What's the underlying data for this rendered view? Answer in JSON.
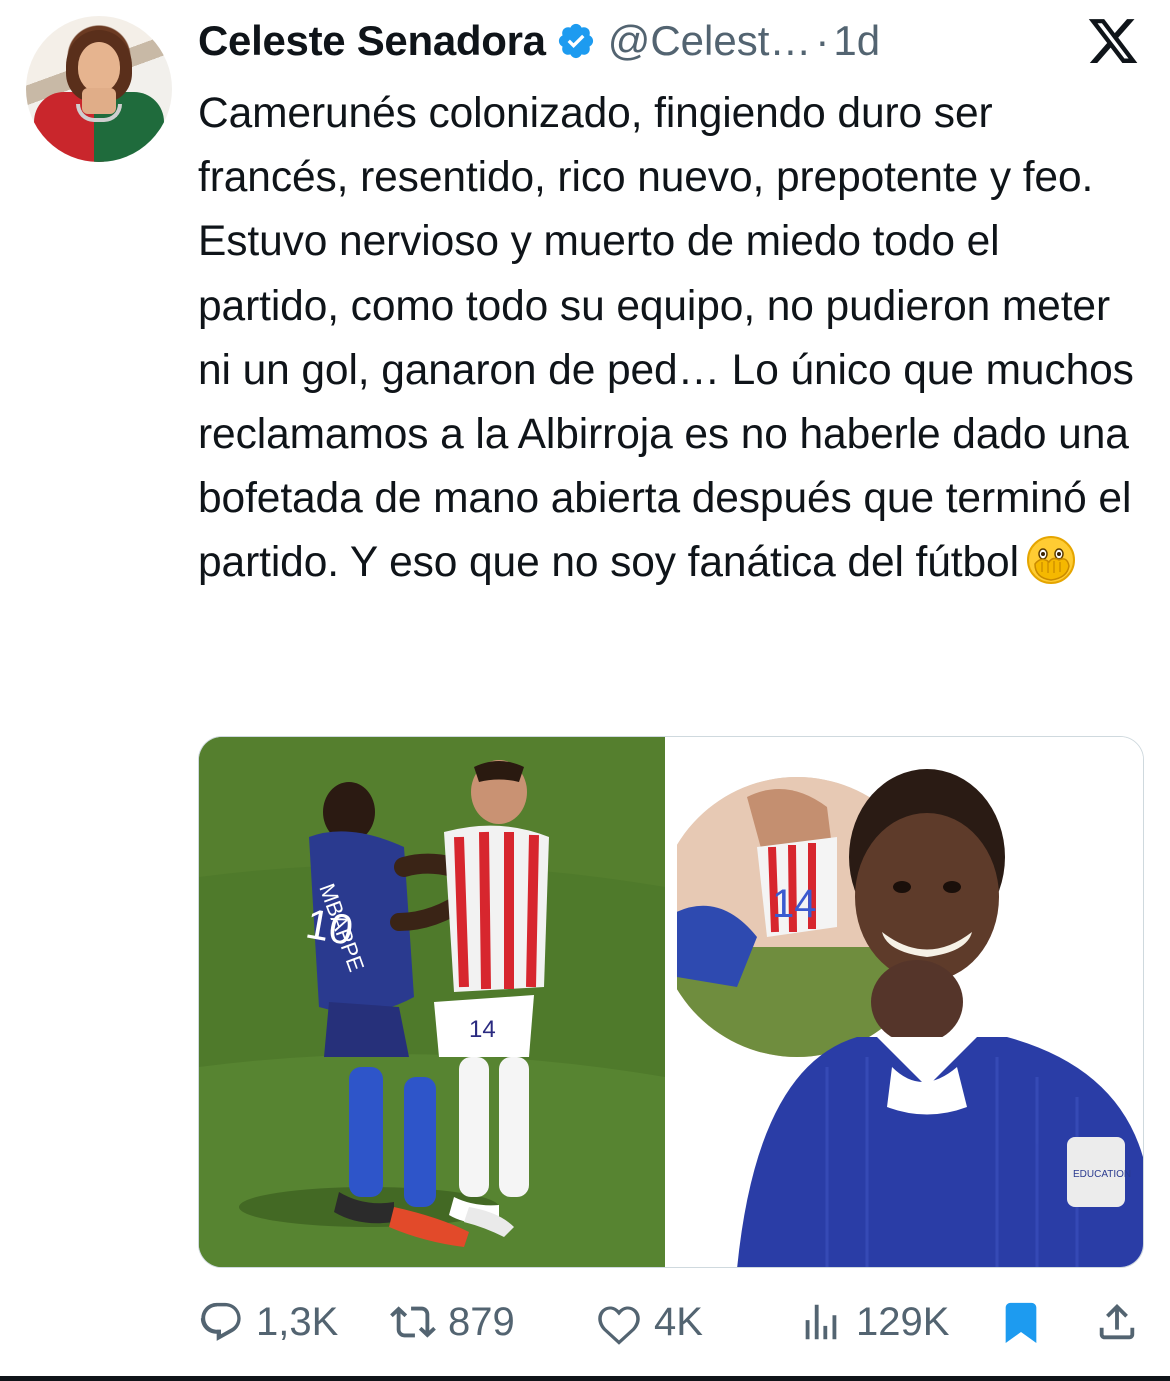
{
  "author": {
    "name": "Celeste Senadora",
    "handle": "@Celest…",
    "separator": "·",
    "time": "1d"
  },
  "tweet": {
    "text": "Camerunés colonizado, fingiendo duro ser francés, resentido, rico nuevo, prepotente y feo. Estuvo nervioso y muerto de miedo todo el partido, como todo su equipo, no pudieron meter ni un gol, ganaron de ped… Lo único que muchos reclamamos a la Albirroja es no haberle dado una bofetada de mano abierta después que terminó el partido. Y eso que no soy fanática del fútbol",
    "emoji": "face-with-open-eyes-and-hand-over-mouth"
  },
  "media": {
    "photo2_badge_text": "EDUCATION"
  },
  "stats": {
    "replies": "1,3K",
    "reposts": "879",
    "likes": "4K",
    "views": "129K"
  },
  "colors": {
    "text": "#0f1419",
    "muted": "#536471",
    "verified": "#1d9bf0",
    "bookmark": "#1d9bf0"
  }
}
